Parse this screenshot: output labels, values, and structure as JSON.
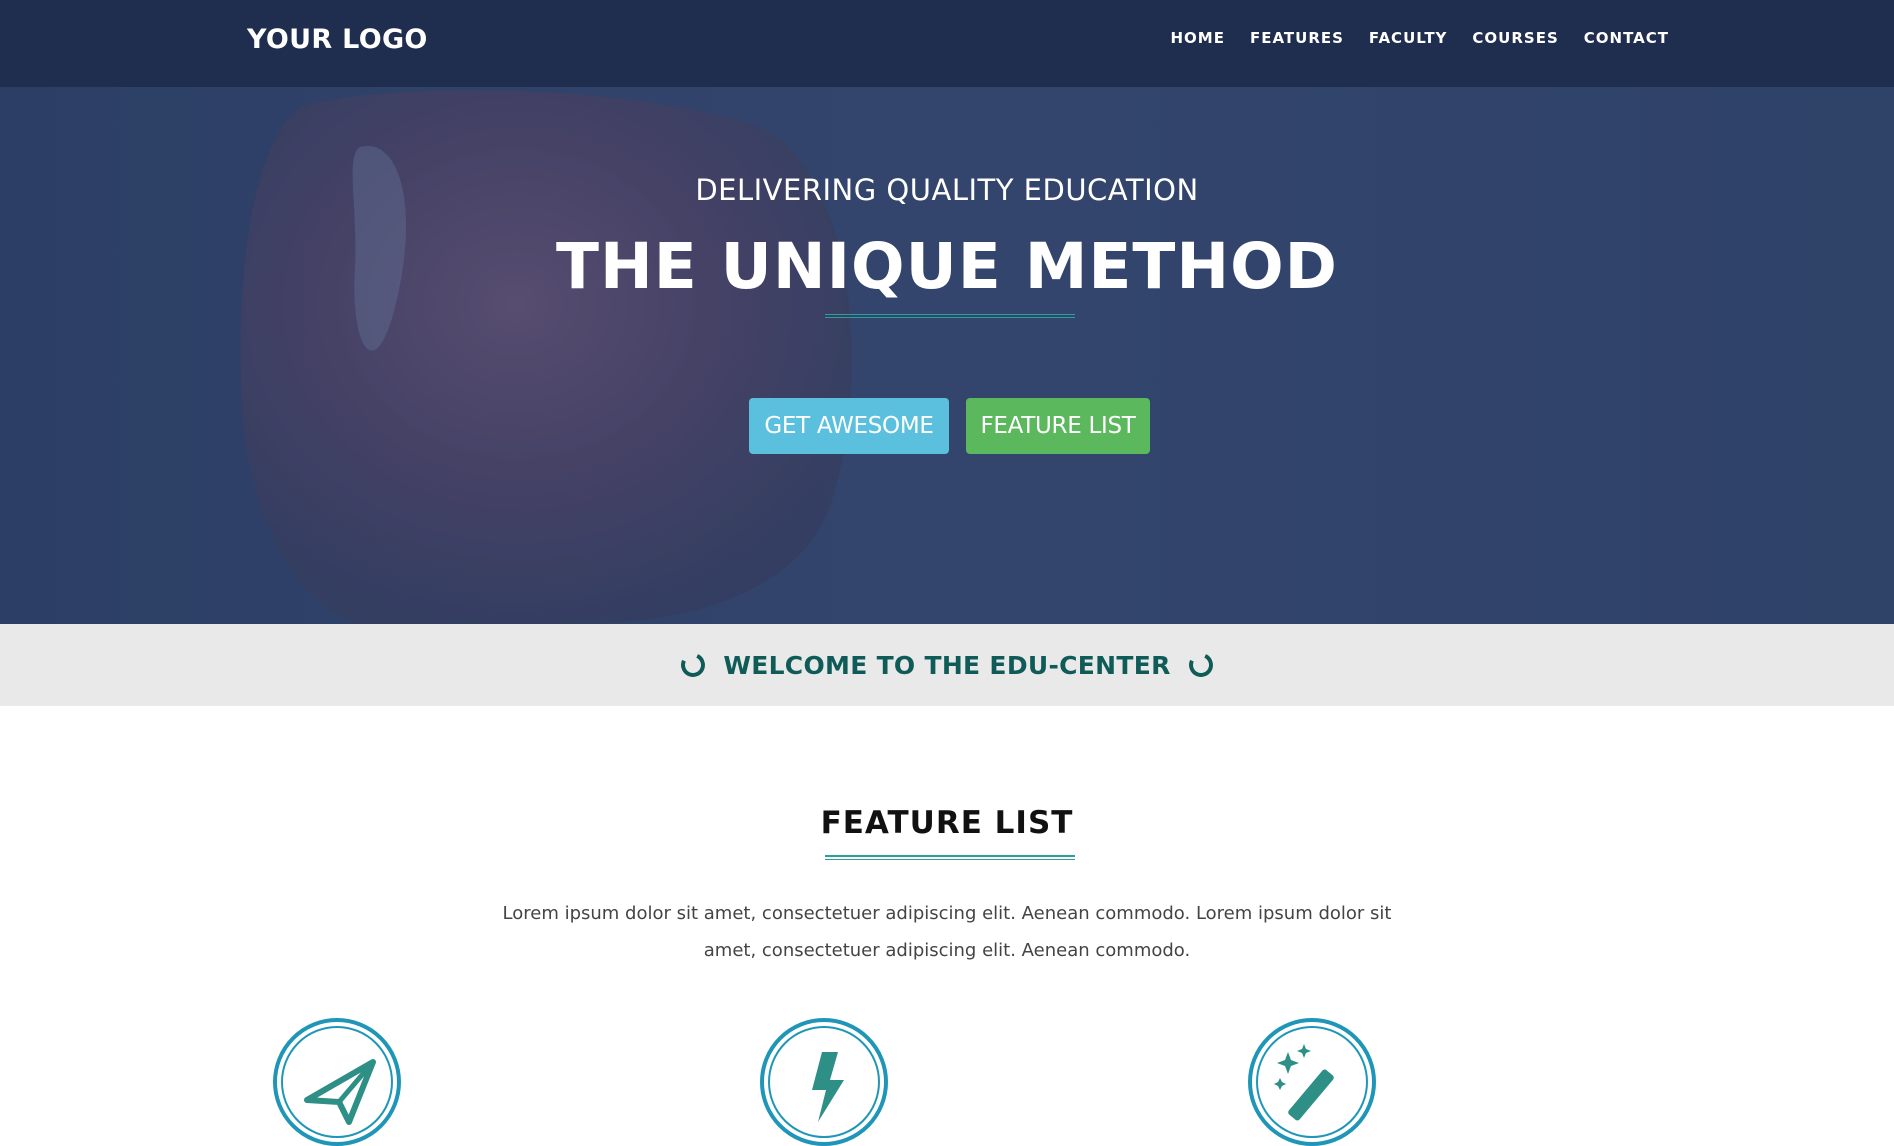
{
  "header": {
    "logo": "YOUR LOGO",
    "nav": [
      "HOME",
      "FEATURES",
      "FACULTY",
      "COURSES",
      "CONTACT"
    ]
  },
  "hero": {
    "subtitle": "DELIVERING QUALITY EDUCATION",
    "title": "THE UNIQUE METHOD",
    "buttons": {
      "primary": "GET AWESOME",
      "secondary": "FEATURE LIST"
    }
  },
  "welcome": {
    "text": "WELCOME TO THE EDU-CENTER"
  },
  "features": {
    "title": "FEATURE LIST",
    "description": "Lorem ipsum dolor sit amet, consectetuer adipiscing elit. Aenean commodo. Lorem ipsum dolor sit amet, consectetuer adipiscing elit. Aenean commodo.",
    "icons": [
      "paper-plane-icon",
      "lightning-icon",
      "magic-wand-icon"
    ]
  },
  "colors": {
    "navbar": "#1f2d4e",
    "accent_teal": "#2aa198",
    "welcome_text": "#0f5b58",
    "btn_info": "#5bc0de",
    "btn_success": "#5cb85c",
    "icon_ring": "#1f96b8"
  }
}
